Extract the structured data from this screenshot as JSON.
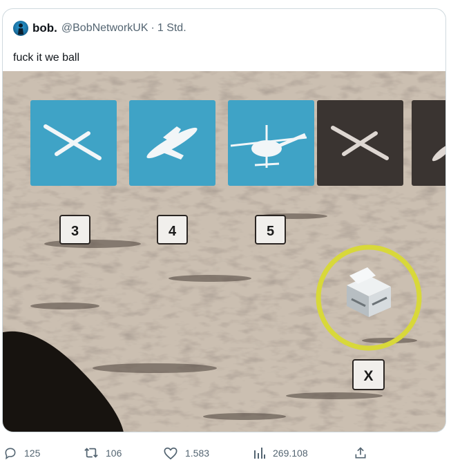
{
  "tweet": {
    "display_name": "bob.",
    "handle": "@BobNetworkUK",
    "separator": "·",
    "time": "1 Std.",
    "text": "fuck it we ball"
  },
  "media": {
    "tiles": [
      {
        "icon": "drone-icon",
        "style": "blue"
      },
      {
        "icon": "plane-icon",
        "style": "blue"
      },
      {
        "icon": "helicopter-icon",
        "style": "blue"
      },
      {
        "icon": "drone-icon",
        "style": "dark"
      },
      {
        "icon": "plane-icon",
        "style": "dark"
      }
    ],
    "keys": [
      "3",
      "4",
      "5"
    ],
    "crate_key": "X",
    "colors": {
      "tile_blue": "#3fa3c6",
      "tile_dark": "#3a3431",
      "ring": "#d8d83a",
      "ground": "#cbbfb1"
    }
  },
  "actions": {
    "replies": "125",
    "reposts": "106",
    "likes": "1.583",
    "views": "269.108"
  }
}
